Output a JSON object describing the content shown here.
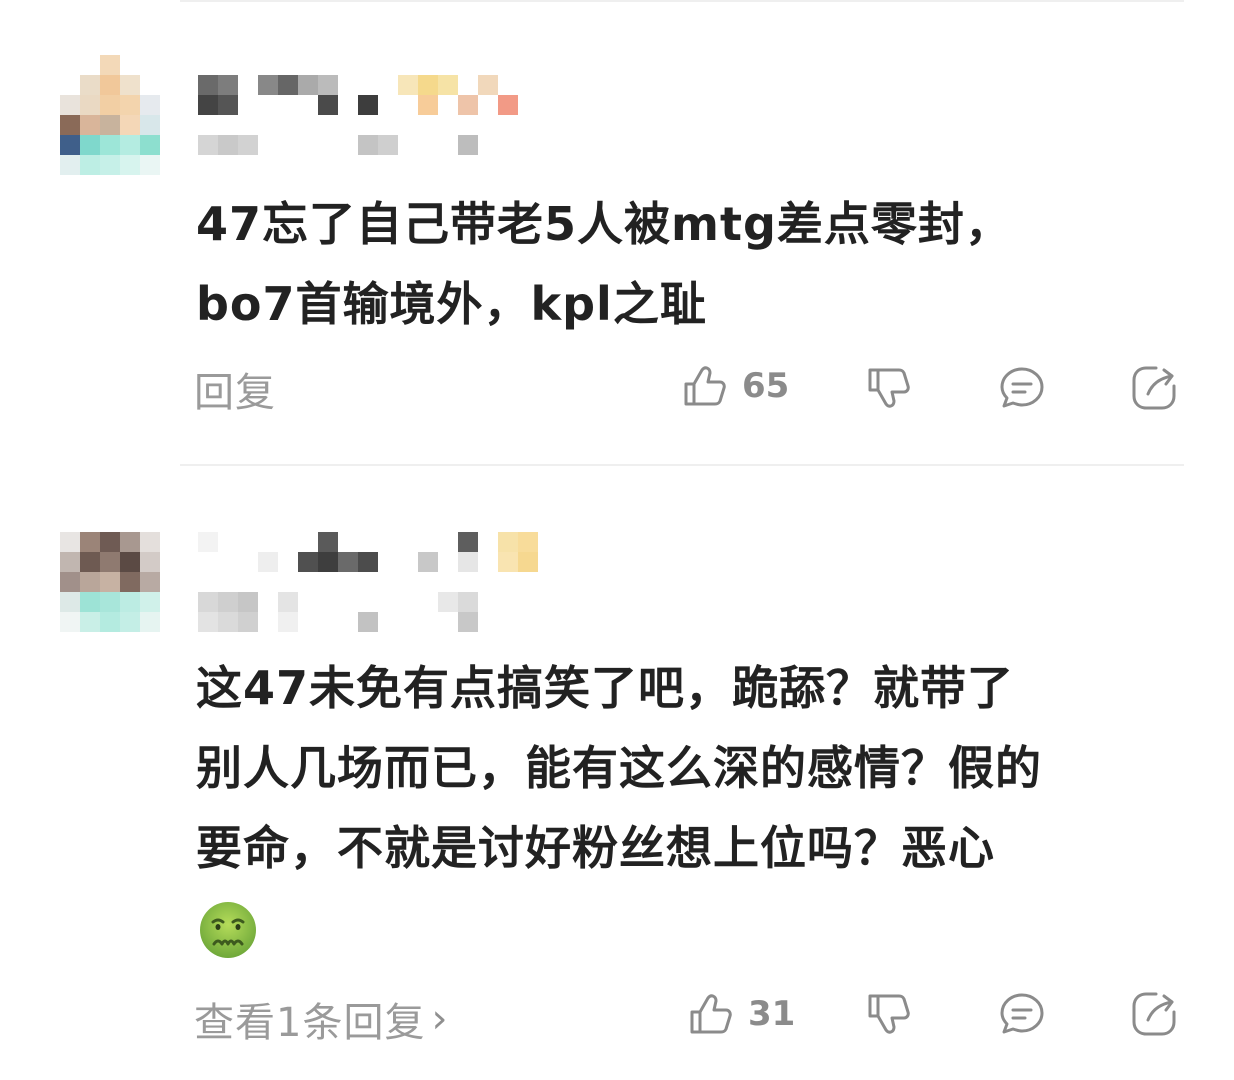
{
  "comments": [
    {
      "body_lines": [
        "47忘了自己带老5人被mtg差点零封，",
        "bo7首输境外，kpl之耻"
      ],
      "reply_label": "回复",
      "like_count": "65"
    },
    {
      "body_lines": [
        "这47未免有点搞笑了吧，跪舔？就带了",
        "别人几场而已，能有这么深的感情？假的",
        "要命，不就是讨好粉丝想上位吗？恶心"
      ],
      "emoji_name": "nauseated-face-icon",
      "reply_label": "查看1条回复",
      "like_count": "31"
    }
  ],
  "icons": {
    "like": "thumbs-up-icon",
    "dislike": "thumbs-down-icon",
    "comment": "comment-bubble-icon",
    "share": "share-icon",
    "chevron": "chevron-right-icon"
  },
  "colors": {
    "text": "#222222",
    "secondary": "#9a9a9a",
    "icon": "#8b8b8b",
    "divider": "#efefef"
  }
}
